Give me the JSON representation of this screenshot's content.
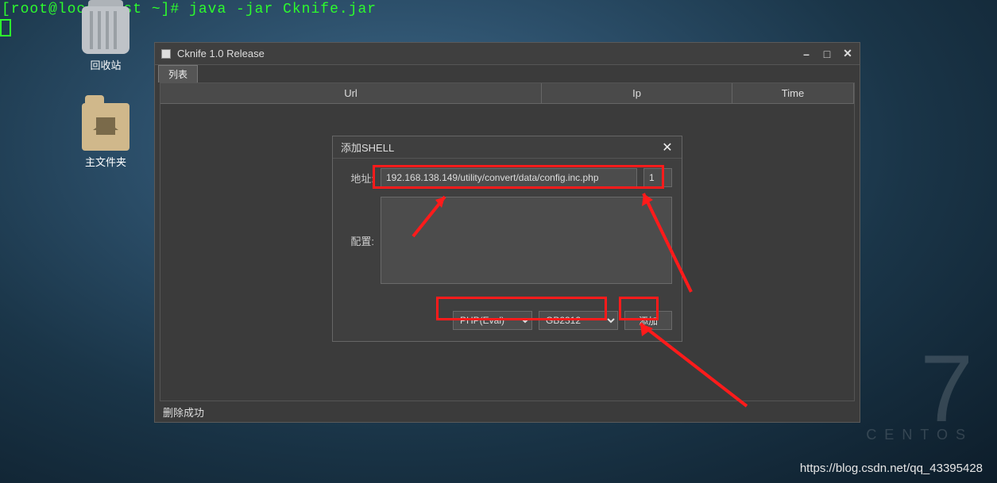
{
  "terminal": {
    "prompt": "[root@localhost ~]# ",
    "command": "java -jar Cknife.jar"
  },
  "desktop": {
    "trash_label": "回收站",
    "home_label": "主文件夹"
  },
  "window": {
    "title": "Cknife 1.0 Release",
    "tab_label": "列表",
    "columns": {
      "url": "Url",
      "ip": "Ip",
      "time": "Time"
    },
    "status": "删除成功"
  },
  "dialog": {
    "title": "添加SHELL",
    "addr_label": "地址:",
    "addr_value": "192.168.138.149/utility/convert/data/config.inc.php",
    "key_value": "1",
    "config_label": "配置:",
    "type_value": "PHP(Eval)",
    "charset_value": "GB2312",
    "add_button": "添加"
  },
  "centos": {
    "seven": "7",
    "label": "CENTOS"
  },
  "watermark_url": "https://blog.csdn.net/qq_43395428"
}
